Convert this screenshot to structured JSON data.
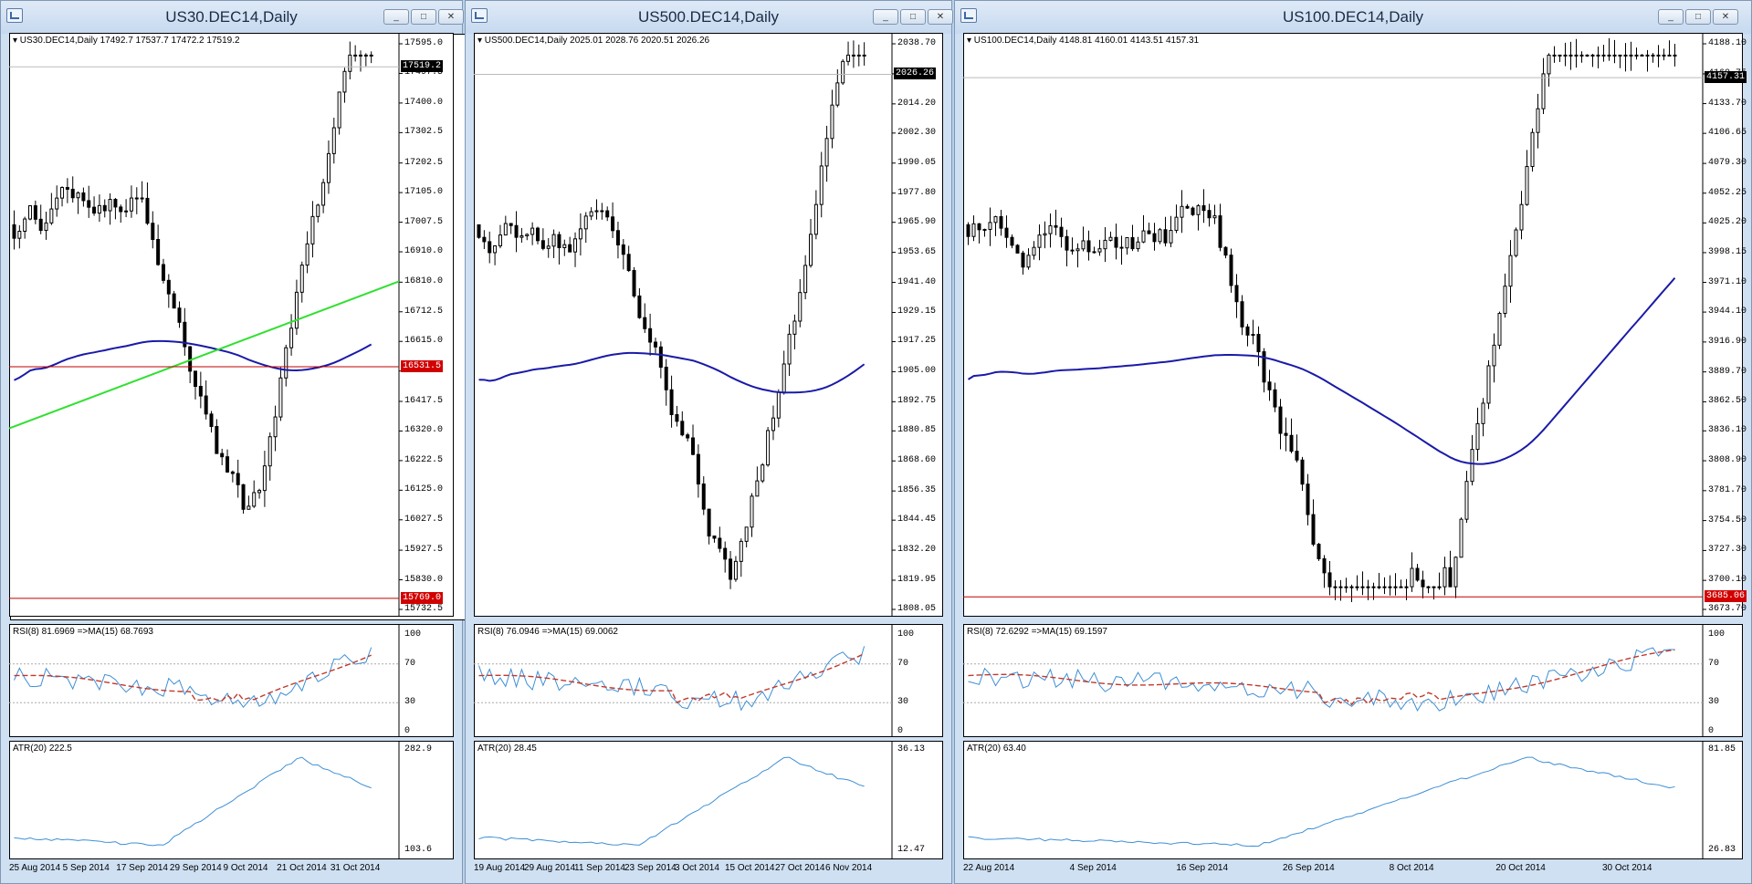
{
  "colors": {
    "rsi": "#3d8fd6",
    "rsi_ma": "#c0392b",
    "atr": "#3d8fd6",
    "sma": "#1a1aa8",
    "trendline": "#2fe02f",
    "hline": "#c00000",
    "candle_up": "#ffffff",
    "candle_down": "#000000"
  },
  "windows": [
    {
      "title": "US30.DEC14,Daily",
      "header": "US30.DEC14,Daily  17492.7 17537.7 17472.2 17519.2",
      "price_ticks": [
        "17595.0",
        "17497.5",
        "17400.0",
        "17302.5",
        "17202.5",
        "17105.0",
        "17007.5",
        "16910.0",
        "16810.0",
        "16712.5",
        "16615.0",
        "16517.5",
        "16417.5",
        "16320.0",
        "16222.5",
        "16125.0",
        "16027.5",
        "15927.5",
        "15830.0",
        "15732.5"
      ],
      "price_range": [
        15732.5,
        17595.0
      ],
      "current_price": "17519.2",
      "hlines": [
        {
          "label": "16531.5",
          "value": 16531.5
        },
        {
          "label": "15769.0",
          "value": 15769.0
        }
      ],
      "rsi_header": "RSI(8) 81.6969  =>MA(15) 68.7693",
      "rsi_ticks": [
        "100",
        "70",
        "30",
        "0"
      ],
      "atr_header": "ATR(20) 222.5",
      "atr_ticks": [
        "282.9",
        "103.6"
      ],
      "dates": [
        "25 Aug 2014",
        "5 Sep 2014",
        "17 Sep 2014",
        "29 Sep 2014",
        "9 Oct 2014",
        "21 Oct 2014",
        "31 Oct 2014"
      ],
      "seed": 3,
      "has_trendline": true
    },
    {
      "title": "US500.DEC14,Daily",
      "header": "US500.DEC14,Daily  2025.01 2028.76 2020.51 2026.26",
      "price_ticks": [
        "2038.70",
        "2026.45",
        "2014.20",
        "2002.30",
        "1990.05",
        "1977.80",
        "1965.90",
        "1953.65",
        "1941.40",
        "1929.15",
        "1917.25",
        "1905.00",
        "1892.75",
        "1880.85",
        "1868.60",
        "1856.35",
        "1844.45",
        "1832.20",
        "1819.95",
        "1808.05"
      ],
      "price_range": [
        1808.05,
        2038.7
      ],
      "current_price": "2026.26",
      "hlines": [],
      "rsi_header": "RSI(8) 76.0946  =>MA(15) 69.0062",
      "rsi_ticks": [
        "100",
        "70",
        "30",
        "0"
      ],
      "atr_header": "ATR(20) 28.45",
      "atr_ticks": [
        "36.13",
        "12.47"
      ],
      "dates": [
        "19 Aug 2014",
        "29 Aug 2014",
        "11 Sep 2014",
        "23 Sep 2014",
        "3 Oct 2014",
        "15 Oct 2014",
        "27 Oct 2014",
        "6 Nov 2014"
      ],
      "seed": 7,
      "has_trendline": false
    },
    {
      "title": "US100.DEC14,Daily",
      "header": "US100.DEC14,Daily  4148.81 4160.01 4143.51 4157.31",
      "price_ticks": [
        "4188.10",
        "4160.75",
        "4133.70",
        "4106.65",
        "4079.30",
        "4052.25",
        "4025.20",
        "3998.15",
        "3971.10",
        "3944.10",
        "3916.90",
        "3889.70",
        "3862.50",
        "3836.10",
        "3808.90",
        "3781.70",
        "3754.50",
        "3727.30",
        "3700.10",
        "3673.70"
      ],
      "price_range": [
        3673.7,
        4188.1
      ],
      "current_price": "4157.31",
      "hlines": [
        {
          "label": "3685.06",
          "value": 3685.06
        }
      ],
      "rsi_header": "RSI(8) 72.6292  =>MA(15) 69.1597",
      "rsi_ticks": [
        "100",
        "70",
        "30",
        "0"
      ],
      "atr_header": "ATR(20) 63.40",
      "atr_ticks": [
        "81.85",
        "26.83"
      ],
      "dates": [
        "22 Aug 2014",
        "4 Sep 2014",
        "16 Sep 2014",
        "26 Sep 2014",
        "8 Oct 2014",
        "20 Oct 2014",
        "30 Oct 2014"
      ],
      "seed": 11,
      "has_trendline": false
    }
  ]
}
